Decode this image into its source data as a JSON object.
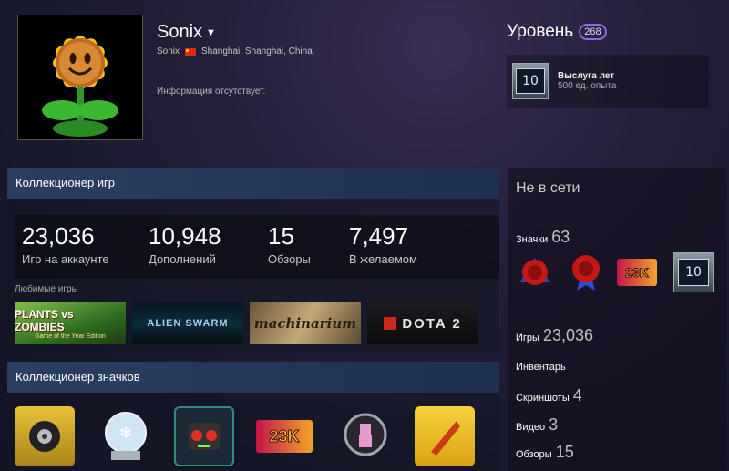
{
  "profile": {
    "name": "Sonix",
    "real_name": "Sonix",
    "location": "Shanghai, Shanghai, China",
    "summary": "Информация отсутствует."
  },
  "level": {
    "title": "Уровень",
    "value": "268"
  },
  "favorite_badge": {
    "number": "10",
    "title": "Выслуга лет",
    "xp": "500 ед. опыта"
  },
  "game_collector": {
    "title": "Коллекционер игр",
    "stats": [
      {
        "value": "23,036",
        "label": "Игр на аккаунте"
      },
      {
        "value": "10,948",
        "label": "Дополнений"
      },
      {
        "value": "15",
        "label": "Обзоры"
      },
      {
        "value": "7,497",
        "label": "В желаемом"
      }
    ],
    "favorites_label": "Любимые игры",
    "games": [
      {
        "name": "PLANTS vs ZOMBIES",
        "sub": "Game of the Year Edition"
      },
      {
        "name": "ALIEN SWARM"
      },
      {
        "name": "machinarium"
      },
      {
        "name": "DOTA 2"
      }
    ]
  },
  "badge_collector": {
    "title": "Коллекционер значков",
    "badge_23k": "23K"
  },
  "sidebar": {
    "status": "Не в сети",
    "badges_label": "Значки",
    "badges_count": "63",
    "badge_23k": "23K",
    "badge_10": "10",
    "games_label": "Игры",
    "games_count": "23,036",
    "inventory_label": "Инвентарь",
    "screenshots_label": "Скриншоты",
    "screenshots_count": "4",
    "videos_label": "Видео",
    "videos_count": "3",
    "reviews_label": "Обзоры",
    "reviews_count": "15"
  }
}
